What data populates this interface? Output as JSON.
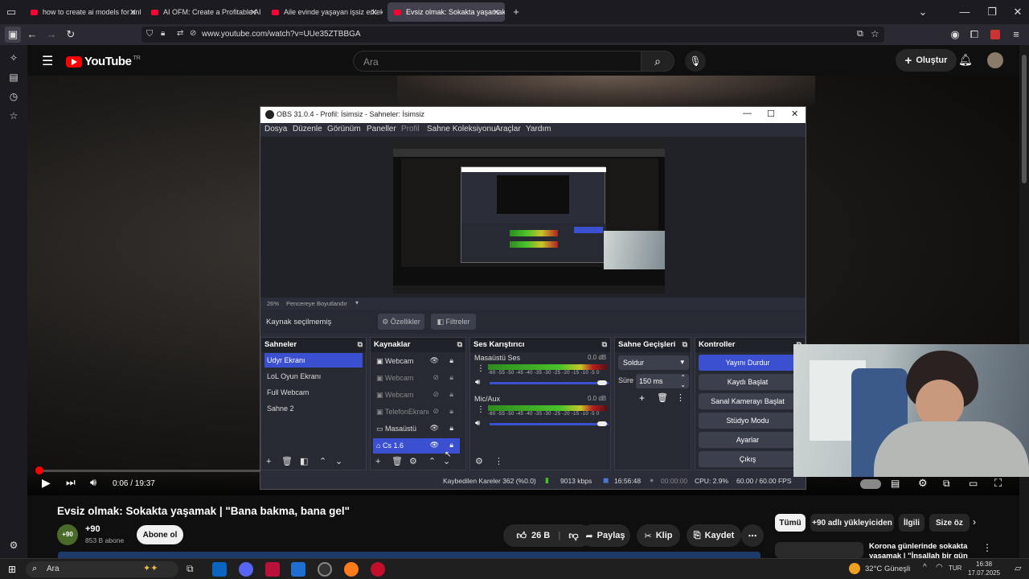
{
  "browser": {
    "tabs": [
      {
        "title": "how to create ai models for onl"
      },
      {
        "title": "AI OFM: Create a Profitable AI M"
      },
      {
        "title": "Aile evinde yaşayan işsiz erkek -"
      },
      {
        "title": "Evsiz olmak: Sokakta yaşamak |"
      }
    ],
    "url": "www.youtube.com/watch?v=UUe35ZTBBGA"
  },
  "youtube": {
    "logo_text": "YouTube",
    "region": "TR",
    "search_placeholder": "Ara",
    "create_label": "Oluştur",
    "video_time": "0:06 / 19:37",
    "video_title": "Evsiz olmak: Sokakta yaşamak | \"Bana bakma, bana gel\"",
    "channel": {
      "name": "+90",
      "subscribers": "853 B abone",
      "avatar_text": "+90"
    },
    "subscribe_label": "Abone ol",
    "actions": {
      "likes": "26 B",
      "share": "Paylaş",
      "clip": "Klip",
      "save": "Kaydet"
    },
    "filters": [
      "Tümü",
      "+90 adlı yükleyiciden",
      "İlgili",
      "Size öz"
    ],
    "rec_title": "Korona günlerinde sokakta yaşamak | \"İnşallah bir gün biz"
  },
  "obs": {
    "title": "OBS 31.0.4 - Profil: İsimsiz - Sahneler: İsimsiz",
    "menu": [
      "Dosya",
      "Düzenle",
      "Görünüm",
      "Paneller",
      "Profil",
      "Sahne Koleksiyonu",
      "Araçlar",
      "Yardım"
    ],
    "zoom": "26%",
    "zoom_mode": "Pencereye Boyutlandır",
    "no_source": "Kaynak seçilmemiş",
    "properties": "Özellikler",
    "filters": "Filtreler",
    "docks": {
      "scenes": {
        "title": "Sahneler",
        "items": [
          "Udyr Ekranı",
          "LoL Oyun Ekranı",
          "Full Webcam",
          "Sahne 2"
        ]
      },
      "sources": {
        "title": "Kaynaklar",
        "items": [
          {
            "name": "Webcam",
            "icon": "camera-icon"
          },
          {
            "name": "Webcam",
            "icon": "camera-icon"
          },
          {
            "name": "Webcam",
            "icon": "camera-icon"
          },
          {
            "name": "TelefonEkranı",
            "icon": "camera-icon"
          },
          {
            "name": "Masaüstü",
            "icon": "monitor-icon"
          },
          {
            "name": "Cs 1.6",
            "icon": "gamepad-icon"
          }
        ]
      },
      "mixer": {
        "title": "Ses Karıştırıcı",
        "channels": [
          {
            "name": "Masaüstü Ses",
            "db": "0.0 dB"
          },
          {
            "name": "Mic/Aux",
            "db": "0.0 dB"
          }
        ],
        "ticks": "-60 -55 -50 -45 -40 -35 -30 -25 -20 -15 -10 -5 0"
      },
      "transitions": {
        "title": "Sahne Geçişleri",
        "selected": "Soldur",
        "duration_label": "Süre",
        "duration": "150 ms"
      },
      "controls": {
        "title": "Kontroller",
        "buttons": [
          "Yayını Durdur",
          "Kaydı Başlat",
          "Sanal Kamerayı Başlat",
          "Stüdyo Modu",
          "Ayarlar",
          "Çıkış"
        ]
      }
    },
    "status": {
      "dropped": "Kaybedilen Kareler 362 (%0.0)",
      "bitrate": "9013 kbps",
      "live": "16:56:48",
      "rec": "00:00:00",
      "cpu": "CPU: 2.9%",
      "fps": "60.00 / 60.00 FPS"
    }
  },
  "taskbar": {
    "search": "Ara",
    "weather": "32°C",
    "weather_desc": "Güneşli",
    "lang": "TUR",
    "time": "16:38",
    "date": "17.07.2025"
  }
}
